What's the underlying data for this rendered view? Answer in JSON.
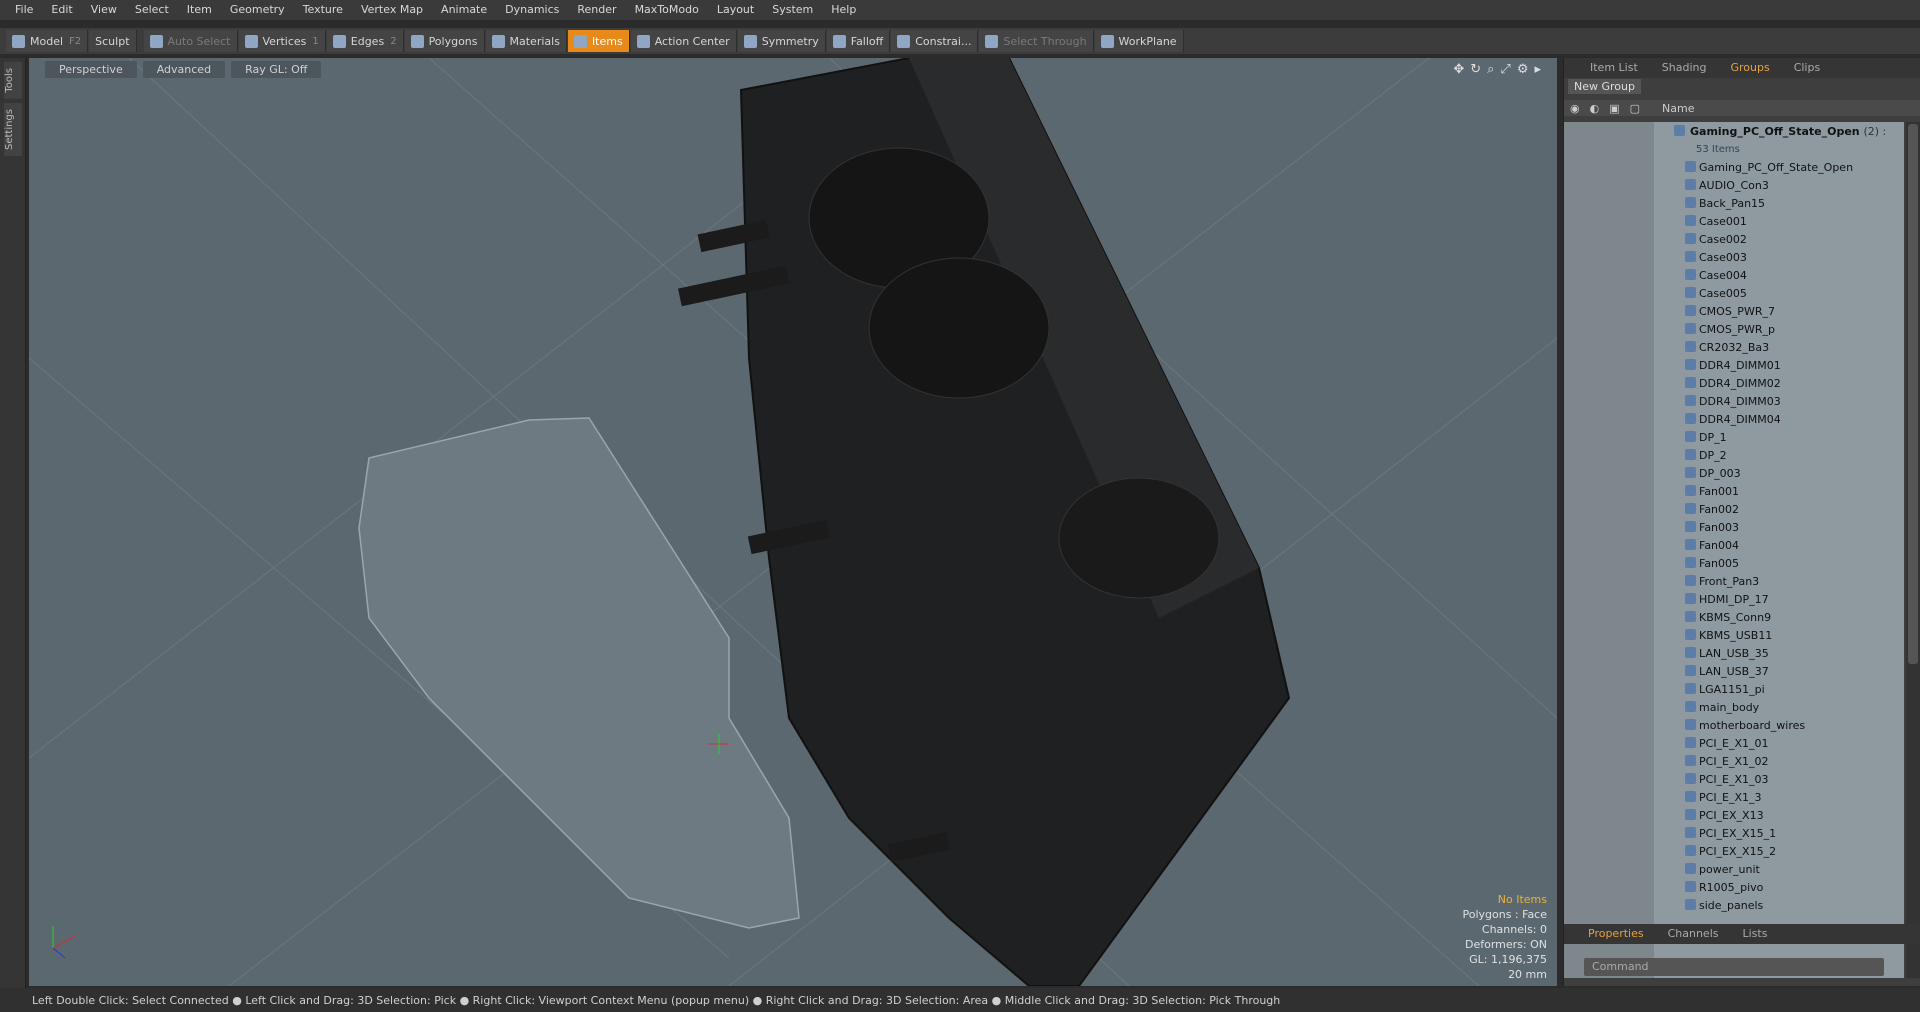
{
  "menu": [
    "File",
    "Edit",
    "View",
    "Select",
    "Item",
    "Geometry",
    "Texture",
    "Vertex Map",
    "Animate",
    "Dynamics",
    "Render",
    "MaxToModo",
    "Layout",
    "System",
    "Help"
  ],
  "toolbar": {
    "model": "Model",
    "model_key": "F2",
    "sculpt": "Sculpt",
    "auto_select": "Auto Select",
    "vertices": "Vertices",
    "vertices_key": "1",
    "edges": "Edges",
    "edges_key": "2",
    "polygons": "Polygons",
    "materials": "Materials",
    "items": "Items",
    "action_center": "Action Center",
    "symmetry": "Symmetry",
    "falloff": "Falloff",
    "constraints": "Constrai...",
    "select_through": "Select Through",
    "workplane": "WorkPlane"
  },
  "left_tabs": [
    "Tools",
    "Settings"
  ],
  "viewport": {
    "perspective": "Perspective",
    "advanced": "Advanced",
    "raygl": "Ray GL: Off",
    "info": {
      "no_items": "No Items",
      "polygons": "Polygons : Face",
      "channels": "Channels: 0",
      "deformers": "Deformers: ON",
      "gl": "GL: 1,196,375",
      "scale": "20 mm"
    }
  },
  "status": "Left Double Click: Select Connected ● Left Click and Drag: 3D Selection: Pick ● Right Click: Viewport Context Menu (popup menu) ● Right Click and Drag: 3D Selection: Area ● Middle Click and Drag: 3D Selection: Pick Through",
  "panel": {
    "tabs": [
      "Item List",
      "Shading",
      "Groups",
      "Clips"
    ],
    "new_group": "New Group",
    "name_header": "Name",
    "group_name": "Gaming_PC_Off_State_Open",
    "group_count": "(2) :",
    "group_sub": "53 Items",
    "items": [
      "Gaming_PC_Off_State_Open",
      "AUDIO_Con3",
      "Back_Pan15",
      "Case001",
      "Case002",
      "Case003",
      "Case004",
      "Case005",
      "CMOS_PWR_7",
      "CMOS_PWR_p",
      "CR2032_Ba3",
      "DDR4_DIMM01",
      "DDR4_DIMM02",
      "DDR4_DIMM03",
      "DDR4_DIMM04",
      "DP_1",
      "DP_2",
      "DP_003",
      "Fan001",
      "Fan002",
      "Fan003",
      "Fan004",
      "Fan005",
      "Front_Pan3",
      "HDMI_DP_17",
      "KBMS_Conn9",
      "KBMS_USB11",
      "LAN_USB_35",
      "LAN_USB_37",
      "LGA1151_pi",
      "main_body",
      "motherboard_wires",
      "PCI_E_X1_01",
      "PCI_E_X1_02",
      "PCI_E_X1_03",
      "PCI_E_X1_3",
      "PCI_EX_X13",
      "PCI_EX_X15_1",
      "PCI_EX_X15_2",
      "power_unit",
      "R1005_pivo",
      "side_panels"
    ],
    "prop_tabs": [
      "Properties",
      "Channels",
      "Lists"
    ],
    "command": "Command"
  }
}
